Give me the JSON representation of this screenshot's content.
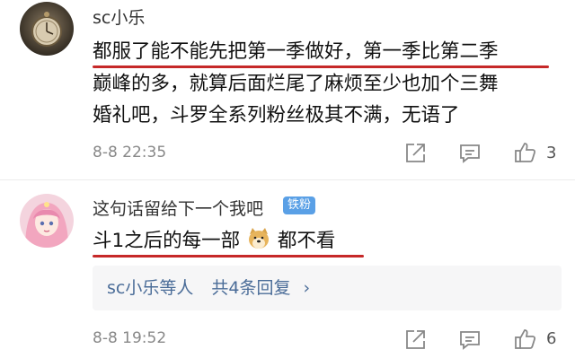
{
  "comments": [
    {
      "username": "sc小乐",
      "lines": [
        "都服了能不能先把第一季做好，第一季比第二季",
        "巅峰的多，就算后面烂尾了麻烦至少也加个三舞",
        "婚礼吧，斗罗全系列粉丝极其不满，无语了"
      ],
      "timestamp": "8-8 22:35",
      "likes": "3"
    },
    {
      "username": "这句话留给下一个我吧",
      "badge": "铁粉",
      "text_before_emoji": "斗1之后的每一部",
      "text_after_emoji": "都不看",
      "reply_summary": {
        "users": "sc小乐等人",
        "count_text": "共4条回复",
        "chevron": "›"
      },
      "timestamp": "8-8 19:52",
      "likes": "6"
    }
  ],
  "icons": {
    "share": "share-icon",
    "reply": "comment-icon",
    "like": "thumbs-up-icon",
    "emoji": "doge-emoji"
  },
  "colors": {
    "underline": "#c62828",
    "link": "#4a6c98",
    "badge": "#5aa0e6"
  }
}
